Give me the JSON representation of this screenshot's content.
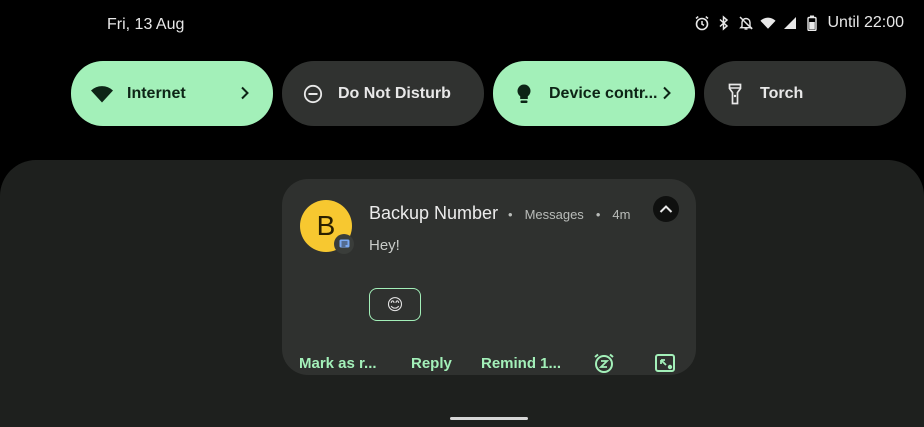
{
  "status_bar": {
    "date": "Fri, 13 Aug",
    "icons": [
      "alarm-icon",
      "bluetooth-icon",
      "notifications-off-icon",
      "wifi-icon",
      "signal-icon",
      "battery-icon"
    ],
    "until_text": "Until 22:00"
  },
  "quick_tiles": [
    {
      "label": "Internet",
      "icon": "wifi-icon",
      "active": true,
      "has_chevron": true
    },
    {
      "label": "Do Not Disturb",
      "icon": "do-not-disturb-icon",
      "active": false,
      "has_chevron": false
    },
    {
      "label": "Device contr...",
      "icon": "lightbulb-icon",
      "active": true,
      "has_chevron": true
    },
    {
      "label": "Torch",
      "icon": "torch-icon",
      "active": false,
      "has_chevron": false
    }
  ],
  "notification": {
    "avatar_letter": "B",
    "sender": "Backup Number",
    "app": "Messages",
    "time": "4m",
    "separator": "•",
    "message": "Hey!",
    "smart_reply": "😊",
    "actions": {
      "mark_as_read": "Mark as r...",
      "reply": "Reply",
      "remind": "Remind 1..."
    },
    "action_icons": [
      "snooze-icon",
      "bubble-icon"
    ]
  },
  "colors": {
    "accent": "#a3f0b9",
    "tile_off": "#303230",
    "shade": "#1e201e",
    "card": "#2f312f",
    "avatar": "#f7c830"
  }
}
